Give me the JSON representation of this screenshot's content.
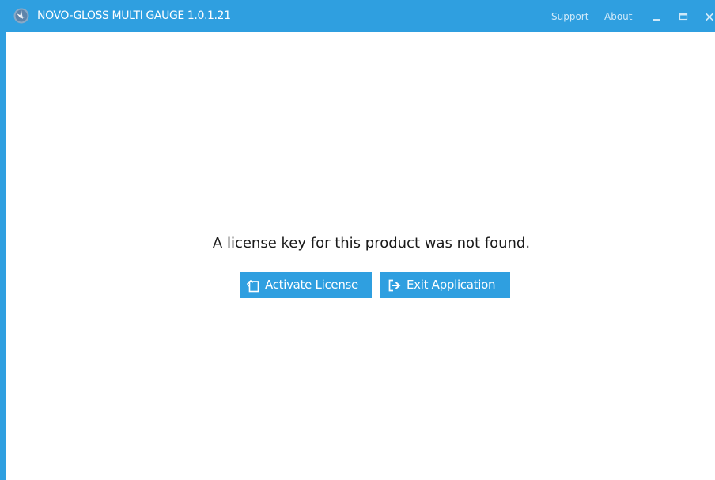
{
  "window": {
    "title": "NOVO-GLOSS MULTI GAUGE 1.0.1.21",
    "accent_color": "#2f9fe0",
    "links": {
      "support": "Support",
      "about": "About"
    },
    "controls": [
      "minimize-icon",
      "maximize-icon",
      "close-icon"
    ]
  },
  "main": {
    "message": "A license key for this product was not found.",
    "buttons": {
      "activate": {
        "label": "Activate License",
        "icon": "license-activate-icon"
      },
      "exit": {
        "label": "Exit Application",
        "icon": "exit-app-icon"
      }
    }
  }
}
